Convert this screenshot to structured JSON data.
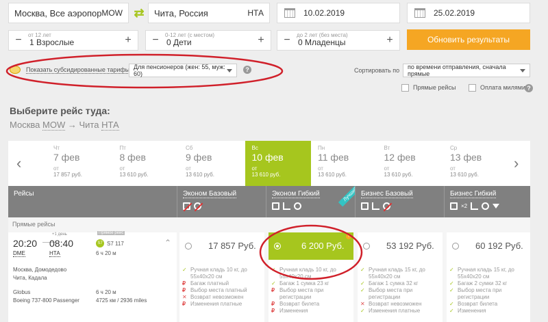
{
  "search": {
    "from_city": "Москва, Все аэропорты",
    "from_code": "MOW",
    "to_city": "Чита, Россия",
    "to_code": "НТА",
    "date_out": "10.02.2019",
    "date_back": "25.02.2019"
  },
  "passengers": {
    "adults_hint": "от 12 лет",
    "adults": "1 Взрослые",
    "children_hint": "0-12 лет (с местом)",
    "children": "0 Дети",
    "infants_hint": "до 2 лет (без места)",
    "infants": "0 Младенцы",
    "minus": "−",
    "plus": "+"
  },
  "update_button": "Обновить результаты",
  "subsidy": {
    "label": "Показать субсидированные тарифы",
    "select_value": "Для пенсионеров (жен: 55, муж: 60)",
    "info": "?"
  },
  "sort": {
    "label": "Сортировать по",
    "value": "по времени отправления, сначала прямые"
  },
  "filters": {
    "direct": "Прямые рейсы",
    "miles": "Оплата милями"
  },
  "section": {
    "title": "Выберите рейс туда:",
    "route_from": "Москва",
    "route_from_code": "MOW",
    "arrow": "→",
    "route_to": "Чита",
    "route_to_code": "НТА"
  },
  "dates": [
    {
      "dow": "Чт",
      "day": "7 фев",
      "ot": "от",
      "price": "17 857 руб.",
      "active": false
    },
    {
      "dow": "Пт",
      "day": "8 фев",
      "ot": "от",
      "price": "13 610 руб.",
      "active": false
    },
    {
      "dow": "Сб",
      "day": "9 фев",
      "ot": "от",
      "price": "13 610 руб.",
      "active": false
    },
    {
      "dow": "Вс",
      "day": "10 фев",
      "ot": "от",
      "price": "13 610 руб.",
      "active": true
    },
    {
      "dow": "Пн",
      "day": "11 фев",
      "ot": "от",
      "price": "13 610 руб.",
      "active": false
    },
    {
      "dow": "Вт",
      "day": "12 фев",
      "ot": "от",
      "price": "13 610 руб.",
      "active": false
    },
    {
      "dow": "Ср",
      "day": "13 фев",
      "ot": "от",
      "price": "13 610 руб.",
      "active": false
    }
  ],
  "nav": {
    "prev": "‹",
    "next": "›"
  },
  "table": {
    "flights_header": "Рейсы",
    "fares": [
      {
        "name": "Эконом Базовый"
      },
      {
        "name": "Эконом Гибкий",
        "badge": "Лучший"
      },
      {
        "name": "Бизнес Базовый"
      },
      {
        "name": "Бизнес Гибкий",
        "icon_suffix": "×2"
      }
    ],
    "direct_label": "Прямые рейсы"
  },
  "flight": {
    "dep_time": "20:20",
    "arr_plus": "+1 день",
    "arr_time": "08:40",
    "dep_code": "DME",
    "arr_code": "НТА",
    "badge": "Прямое рейс",
    "airline_code": "S7",
    "flight_no": "S7 117",
    "duration": "6 ч 20 м",
    "dep_airport": "Москва, Домодедово",
    "arr_airport": "Чита, Кадала",
    "carrier": "Globus",
    "aircraft": "Boeing 737-800 Passenger",
    "duration2": "6 ч 20 м",
    "distance": "4725 км / 2936 miles"
  },
  "fare_prices": [
    {
      "price": "17 857 Руб.",
      "selected": false
    },
    {
      "price": "6 200 Руб.",
      "selected": true
    },
    {
      "price": "53 192 Руб.",
      "selected": false
    },
    {
      "price": "60 192 Руб.",
      "selected": false
    }
  ],
  "fare_features": [
    [
      {
        "mark": "ok",
        "text": "Ручная кладь 10 кг, до 55х40х20 см"
      },
      {
        "mark": "rub",
        "text": "Багаж платный"
      },
      {
        "mark": "rub",
        "text": "Выбор места платный"
      },
      {
        "mark": "no",
        "text": "Возврат невозможен"
      },
      {
        "mark": "rub",
        "text": "Изменения платные"
      }
    ],
    [
      {
        "mark": "ok",
        "text": "Ручная кладь 10 кг, до 55х40х20 см"
      },
      {
        "mark": "ok",
        "text": "Багаж 1 сумка 23 кг"
      },
      {
        "mark": "rub",
        "text": "Выбор места при регистрации"
      },
      {
        "mark": "rub",
        "text": "Возврат билета"
      },
      {
        "mark": "rub",
        "text": "Изменения"
      }
    ],
    [
      {
        "mark": "ok",
        "text": "Ручная кладь 15 кг, до 55х40х20 см"
      },
      {
        "mark": "ok",
        "text": "Багаж 1 сумка 32 кг"
      },
      {
        "mark": "ok",
        "text": "Выбор места при регистрации"
      },
      {
        "mark": "no",
        "text": "Возврат невозможен"
      },
      {
        "mark": "ok",
        "text": "Изменения платные"
      }
    ],
    [
      {
        "mark": "ok",
        "text": "Ручная кладь 15 кг, до 55х40х20 см"
      },
      {
        "mark": "ok",
        "text": "Багаж 2 сумки 32 кг"
      },
      {
        "mark": "ok",
        "text": "Выбор места при регистрации"
      },
      {
        "mark": "ok",
        "text": "Возврат билета"
      },
      {
        "mark": "ok",
        "text": "Изменения"
      }
    ]
  ],
  "colors": {
    "accent_green": "#a6c61e",
    "orange": "#f5a623",
    "header_gray": "#808080",
    "annotation_red": "#d0202a",
    "badge_teal": "#33c3c3"
  }
}
